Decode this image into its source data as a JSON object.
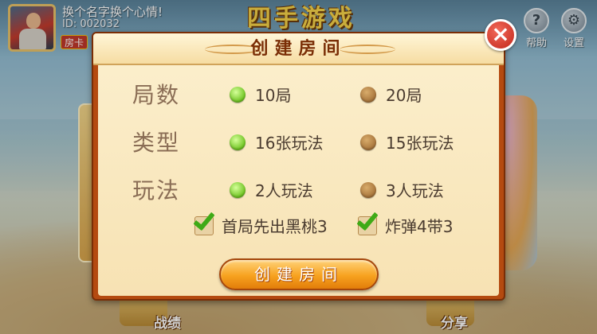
{
  "lobby": {
    "user": {
      "nickname": "换个名字换个心情!",
      "id": "ID: 002032",
      "room_card_label": "房卡"
    },
    "game_title": "四手游戏",
    "top_buttons": [
      {
        "label": "帮助",
        "icon": "help-icon",
        "glyph": "?"
      },
      {
        "label": "设置",
        "icon": "gear-icon",
        "glyph": "⚙"
      }
    ],
    "bottom_buttons": [
      {
        "label": "战绩",
        "icon": "record-icon"
      },
      {
        "label": "分享",
        "icon": "share-icon"
      }
    ]
  },
  "dialog": {
    "title": "创建房间",
    "close_icon": "close-icon",
    "rows": [
      {
        "label": "局数",
        "options": [
          {
            "text": "10局",
            "selected": true
          },
          {
            "text": "20局",
            "selected": false
          }
        ]
      },
      {
        "label": "类型",
        "options": [
          {
            "text": "16张玩法",
            "selected": true
          },
          {
            "text": "15张玩法",
            "selected": false
          }
        ]
      },
      {
        "label": "玩法",
        "options": [
          {
            "text": "2人玩法",
            "selected": true
          },
          {
            "text": "3人玩法",
            "selected": false
          }
        ]
      }
    ],
    "checkboxes": [
      {
        "text": "首局先出黑桃3",
        "checked": true
      },
      {
        "text": "炸弹4带3",
        "checked": true
      }
    ],
    "create_button_label": "创建房间"
  },
  "colors": {
    "radio_selected": "#6cc21f",
    "radio_unselected": "#a6733a",
    "dialog_border": "#b44a10",
    "button_orange": "#f7a21f",
    "close_red": "#c0261a"
  }
}
